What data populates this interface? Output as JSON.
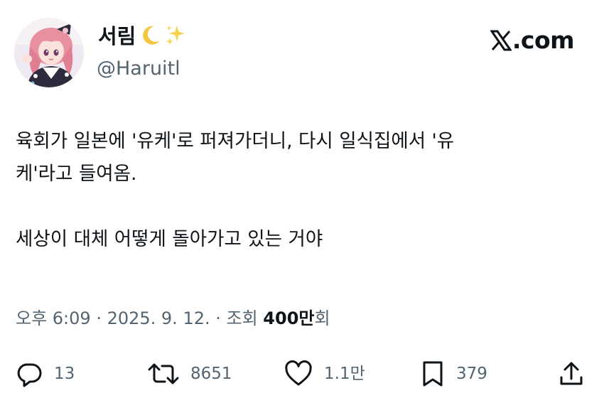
{
  "author": {
    "display_name": "서림",
    "handle": "@Haruitl",
    "avatar_icon": "avatar-anime-illustration",
    "name_emojis": [
      "crescent-moon-icon",
      "sparkles-icon"
    ]
  },
  "brand": {
    "label": ".com",
    "logo_icon": "x-logo-icon"
  },
  "tweet": {
    "line1": "육회가 일본에 '유케'로 퍼져가더니, 다시 일식집에서 '유",
    "line2": "케'라고 들여옴.",
    "line3": "세상이 대체 어떻게 돌아가고 있는 거야"
  },
  "meta": {
    "time": "오후 6:09",
    "sep1": " · ",
    "date": "2025. 9. 12.",
    "sep2": " · ",
    "views_label": "조회 ",
    "views_number": "400",
    "views_unit_bold": "만",
    "views_suffix": "회"
  },
  "actions": {
    "reply": {
      "icon": "reply-icon",
      "count": "13"
    },
    "repost": {
      "icon": "repost-icon",
      "count": "8651"
    },
    "like": {
      "icon": "heart-icon",
      "count": "1.1만"
    },
    "bookmark": {
      "icon": "bookmark-icon",
      "count": "379"
    },
    "share": {
      "icon": "share-icon"
    }
  },
  "colors": {
    "text": "#0f1419",
    "secondary": "#536471",
    "background": "#ffffff"
  }
}
